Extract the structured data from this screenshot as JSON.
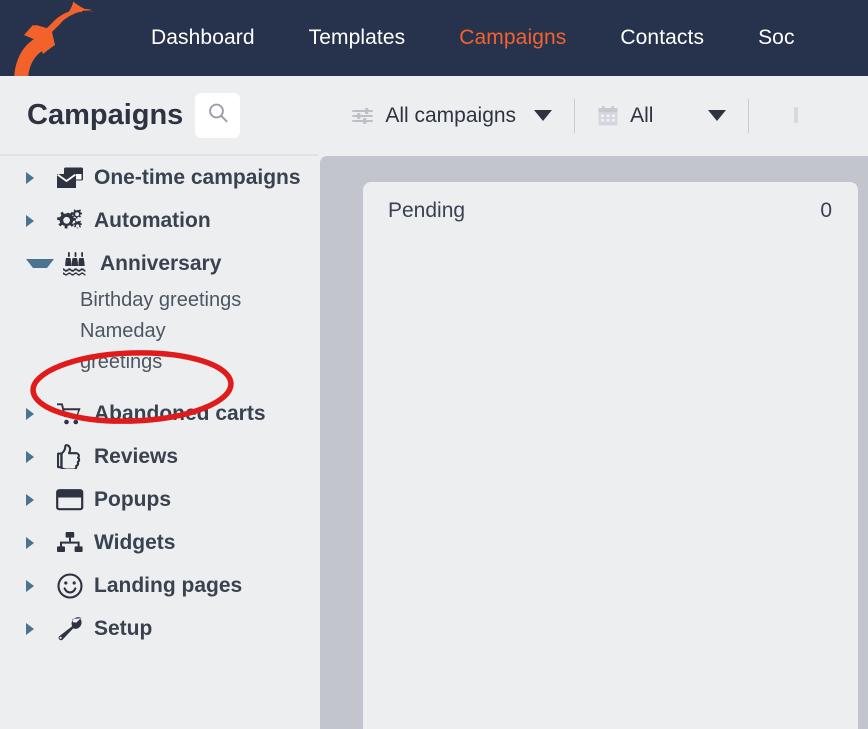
{
  "topnav": {
    "logo_name": "rocket-logo",
    "background": "#27334d",
    "accent": "#f4622b",
    "items": [
      {
        "label": "Dashboard",
        "active": false
      },
      {
        "label": "Templates",
        "active": false
      },
      {
        "label": "Campaigns",
        "active": true
      },
      {
        "label": "Contacts",
        "active": false
      },
      {
        "label": "Soc",
        "active": false
      }
    ]
  },
  "subheader": {
    "title": "Campaigns",
    "search_icon": "search-icon",
    "filters": [
      {
        "icon": "sliders-icon",
        "label": "All campaigns"
      },
      {
        "icon": "calendar-icon",
        "label": "All"
      }
    ]
  },
  "sidebar": {
    "items": [
      {
        "label": "One-time campaigns",
        "icon": "envelopes-icon",
        "expanded": false
      },
      {
        "label": "Automation",
        "icon": "gears-icon",
        "expanded": false
      },
      {
        "label": "Anniversary",
        "icon": "cake-icon",
        "expanded": true
      },
      {
        "label": "Abandoned carts",
        "icon": "shopping-cart-icon",
        "expanded": false
      },
      {
        "label": "Reviews",
        "icon": "thumbs-up-icon",
        "expanded": false
      },
      {
        "label": "Popups",
        "icon": "popup-window-icon",
        "expanded": false
      },
      {
        "label": "Widgets",
        "icon": "sitemap-icon",
        "expanded": false
      },
      {
        "label": "Landing pages",
        "icon": "smiley-icon",
        "expanded": false
      },
      {
        "label": "Setup",
        "icon": "wrench-icon",
        "expanded": false
      }
    ],
    "anniversary_children": [
      {
        "label": "Birthday greetings"
      },
      {
        "label": "Nameday greetings"
      }
    ]
  },
  "annotation": {
    "shape": "ellipse",
    "color": "#e01b1b",
    "targets": "Nameday greetings"
  },
  "main": {
    "rows": [
      {
        "label": "Pending",
        "value": "0"
      }
    ]
  }
}
